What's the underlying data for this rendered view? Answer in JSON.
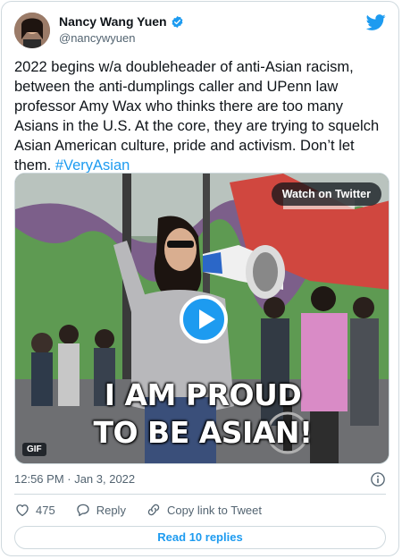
{
  "author": {
    "display_name": "Nancy Wang Yuen",
    "handle": "@nancywyuen",
    "verified": true,
    "avatar_icon": "profile-photo"
  },
  "tweet": {
    "text": "2022 begins w/a doubleheader of anti-Asian racism, between the anti-dumplings caller and UPenn law professor Amy Wax who thinks there are too many Asians in the U.S. At the core, they are trying to squelch Asian American culture, pride and activism. Don’t let them. ",
    "hashtag": "#VeryAsian"
  },
  "media": {
    "watch_label": "Watch on Twitter",
    "caption_line1": "I AM PROUD",
    "caption_line2": "TO BE ASIAN!",
    "badge": "GIF",
    "play_icon": "play-icon"
  },
  "meta": {
    "timestamp": "12:56 PM · Jan 3, 2022",
    "info_icon": "info-icon"
  },
  "actions": {
    "likes": "475",
    "reply_label": "Reply",
    "copy_label": "Copy link to Tweet"
  },
  "footer": {
    "read_replies": "Read 10 replies"
  },
  "colors": {
    "accent": "#1d9bf0",
    "text": "#0f1419",
    "muted": "#536471",
    "border": "#cfd9de"
  }
}
